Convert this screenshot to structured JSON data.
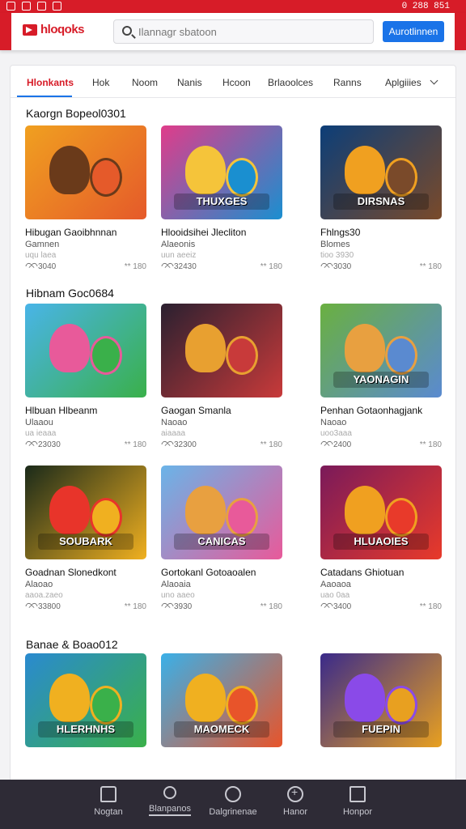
{
  "status": {
    "right_text": "0 288 851"
  },
  "header": {
    "logo_text": "hloqoks",
    "search_placeholder": "Ilannagr sbatoon",
    "cta_label": "Aurotlinnen"
  },
  "tabs": [
    "Hlonkants",
    "Hok",
    "Noom",
    "Nanis",
    "Hcoon",
    "Brlaoolces",
    "Ranns",
    "Aplgiiies"
  ],
  "sections": [
    {
      "title": "Kaorgn Bopeol0301",
      "cards": [
        {
          "title": "Hibugan Gaoibhnnan",
          "sub": "Gamnen",
          "meta": "uqu laea",
          "likes": "3040",
          "rating": "** 180",
          "badge": "",
          "colors": [
            "#f0a020",
            "#6a3a1a",
            "#e55a2a"
          ]
        },
        {
          "title": "Hlooidsihei Jlecliton",
          "sub": "Alaeonis",
          "meta": "uun aeeiz",
          "likes": "32430",
          "rating": "** 180",
          "badge": "THUXGES",
          "colors": [
            "#e03c8a",
            "#f5c43a",
            "#1a8fd0"
          ]
        },
        {
          "title": "Fhlngs30",
          "sub": "Blomes",
          "meta": "tioo 3930",
          "likes": "3030",
          "rating": "** 180",
          "badge": "DIRSNAS",
          "colors": [
            "#0c3e78",
            "#f0a020",
            "#7a4a2a"
          ]
        }
      ]
    },
    {
      "title": "Hibnam Goc0684",
      "cards": [
        {
          "title": "Hlbuan Hlbeanm",
          "sub": "Ulaaou",
          "meta": "ua ieaaa",
          "likes": "23030",
          "rating": "** 180",
          "badge": "",
          "colors": [
            "#49b4e8",
            "#e85a9a",
            "#3ab04a"
          ]
        },
        {
          "title": "Gaogan Smanla",
          "sub": "Naoao",
          "meta": "aiaaaa",
          "likes": "32300",
          "rating": "** 180",
          "badge": "",
          "colors": [
            "#2a2030",
            "#e8a030",
            "#c83a3a"
          ]
        },
        {
          "title": "Penhan Gotaonhagjank",
          "sub": "Naoao",
          "meta": "uoo3aaa",
          "likes": "2400",
          "rating": "** 180",
          "badge": "YAONAGIN",
          "colors": [
            "#6ab040",
            "#e8a040",
            "#5a8ad0"
          ]
        }
      ]
    },
    {
      "title": "",
      "cards": [
        {
          "title": "Goadnan Slonedkont",
          "sub": "Alaoao",
          "meta": "aaoa.zaeo",
          "likes": "33800",
          "rating": "** 180",
          "badge": "SOUBARK",
          "colors": [
            "#1a2a1a",
            "#e8342a",
            "#f0b020"
          ]
        },
        {
          "title": "Gortokanl Gotoaoalen",
          "sub": "Alaoaia",
          "meta": "uno aaeo",
          "likes": "3930",
          "rating": "** 180",
          "badge": "CANICAS",
          "colors": [
            "#6ab4e8",
            "#e8a040",
            "#e85a9a"
          ]
        },
        {
          "title": "Catadans Ghiotuan",
          "sub": "Aaoaoa",
          "meta": "uao 0aa",
          "likes": "3400",
          "rating": "** 180",
          "badge": "HLUAOIES",
          "colors": [
            "#7a1a5a",
            "#f0a020",
            "#e83a2a"
          ]
        }
      ]
    },
    {
      "title": "Banae & Boao012",
      "cards": [
        {
          "title": "",
          "sub": "",
          "meta": "",
          "likes": "",
          "rating": "",
          "badge": "HLERHNHS",
          "colors": [
            "#2a8ad0",
            "#f0b020",
            "#3ab04a"
          ]
        },
        {
          "title": "",
          "sub": "",
          "meta": "",
          "likes": "",
          "rating": "",
          "badge": "MAOMECK",
          "colors": [
            "#3ab0e8",
            "#f0b020",
            "#e8542a"
          ]
        },
        {
          "title": "",
          "sub": "",
          "meta": "",
          "likes": "",
          "rating": "",
          "badge": "FUEPIN",
          "colors": [
            "#3a2a8a",
            "#8a4ae8",
            "#e8a020"
          ]
        }
      ]
    }
  ],
  "bottom_nav": [
    {
      "label": "Nogtan",
      "icon": "home-icon"
    },
    {
      "label": "Blanpanos",
      "icon": "search-icon"
    },
    {
      "label": "Dalgrinenae",
      "icon": "compass-icon"
    },
    {
      "label": "Hanor",
      "icon": "plus-circle-icon"
    },
    {
      "label": "Honpor",
      "icon": "box-icon"
    }
  ]
}
